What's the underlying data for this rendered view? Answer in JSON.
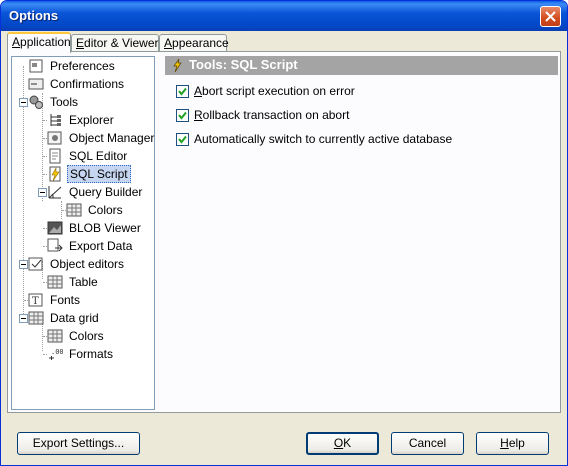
{
  "window": {
    "title": "Options"
  },
  "tabs": [
    {
      "label": "Application",
      "underline": "A",
      "rest": "pplication",
      "active": true
    },
    {
      "label": "Editor & Viewers",
      "underline": "E",
      "rest": "ditor & Viewers"
    },
    {
      "label": "Appearance",
      "underline": "A",
      "rest": "ppearance"
    }
  ],
  "tree": {
    "items": [
      {
        "label": "Preferences",
        "icon": "preferences-icon"
      },
      {
        "label": "Confirmations",
        "icon": "confirmations-icon"
      },
      {
        "label": "Tools",
        "icon": "tools-icon",
        "expanded": true
      },
      {
        "label": "Explorer",
        "icon": "explorer-icon"
      },
      {
        "label": "Object Manager",
        "icon": "object-manager-icon"
      },
      {
        "label": "SQL Editor",
        "icon": "sql-editor-icon"
      },
      {
        "label": "SQL Script",
        "icon": "sql-script-icon",
        "selected": true
      },
      {
        "label": "Query Builder",
        "icon": "query-builder-icon",
        "expanded": true
      },
      {
        "label": "Colors",
        "icon": "colors-icon"
      },
      {
        "label": "BLOB Viewer",
        "icon": "blob-viewer-icon"
      },
      {
        "label": "Export Data",
        "icon": "export-data-icon"
      },
      {
        "label": "Object editors",
        "icon": "object-editors-icon",
        "expanded": true
      },
      {
        "label": "Table",
        "icon": "table-icon"
      },
      {
        "label": "Fonts",
        "icon": "fonts-icon"
      },
      {
        "label": "Data grid",
        "icon": "data-grid-icon",
        "expanded": true
      },
      {
        "label": "Colors",
        "icon": "colors-icon"
      },
      {
        "label": "Formats",
        "icon": "formats-icon"
      }
    ]
  },
  "panel": {
    "title": "Tools: SQL Script",
    "options": [
      {
        "label": "Abort script execution on error",
        "underline": "A",
        "rest": "bort script execution on error",
        "checked": true
      },
      {
        "label": "Rollback transaction on abort",
        "underline": "R",
        "rest": "ollback transaction on abort",
        "checked": true
      },
      {
        "label": "Automatically switch to currently active database",
        "underline": "",
        "rest": "Automatically switch to currently active database",
        "checked": true
      }
    ]
  },
  "buttons": {
    "export_settings": "Export Settings...",
    "ok_u": "O",
    "ok_rest": "K",
    "cancel": "Cancel",
    "help_u": "H",
    "help_rest": "elp"
  },
  "colors": {
    "titlebar": "#0a55d8",
    "header_bg": "#a4a4a4",
    "selection": "#c7d6f0",
    "tab_highlight": "#ffc83c"
  }
}
